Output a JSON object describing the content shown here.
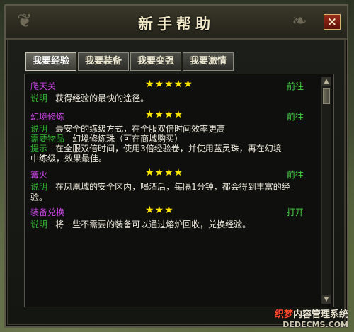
{
  "window": {
    "title": "新手帮助",
    "close_label": "×"
  },
  "tabs": [
    "我要经验",
    "我要装备",
    "我要变强",
    "我要激情"
  ],
  "entries": [
    {
      "name": "爬天关",
      "stars": "★★★★★",
      "action": "前往",
      "lines": [
        {
          "label": "说明",
          "text": "获得经验的最快的途径。"
        }
      ]
    },
    {
      "name": "幻境修炼",
      "stars": "★★★★",
      "action": "前往",
      "lines": [
        {
          "label": "说明",
          "text": "最安全的练级方式，在全服双倍时间效率更高"
        },
        {
          "label": "需要物品",
          "text": "幻境修炼珠（可在商城购买）"
        },
        {
          "label": "提示",
          "text": "在全服双倍时间，使用3倍经验卷，并使用蓝灵珠，再在幻境"
        },
        {
          "label": "",
          "text": "中练级，效果最佳。"
        }
      ]
    },
    {
      "name": "篝火",
      "stars": "★★★★",
      "action": "前往",
      "lines": [
        {
          "label": "说明",
          "text": "在凤凰城的安全区内，喝酒后，每隔1分钟，都会得到丰富的经"
        },
        {
          "label": "",
          "text": "验。"
        }
      ]
    },
    {
      "name": "装备兑换",
      "stars": "★★★",
      "action": "打开",
      "lines": [
        {
          "label": "说明",
          "text": "将一些不需要的装备可以通过熔炉回收，兑换经验。"
        }
      ]
    }
  ],
  "watermark": {
    "line1_a": "织梦",
    "line1_b": "内容管理系统",
    "line2": "DEDECMS.COM"
  }
}
